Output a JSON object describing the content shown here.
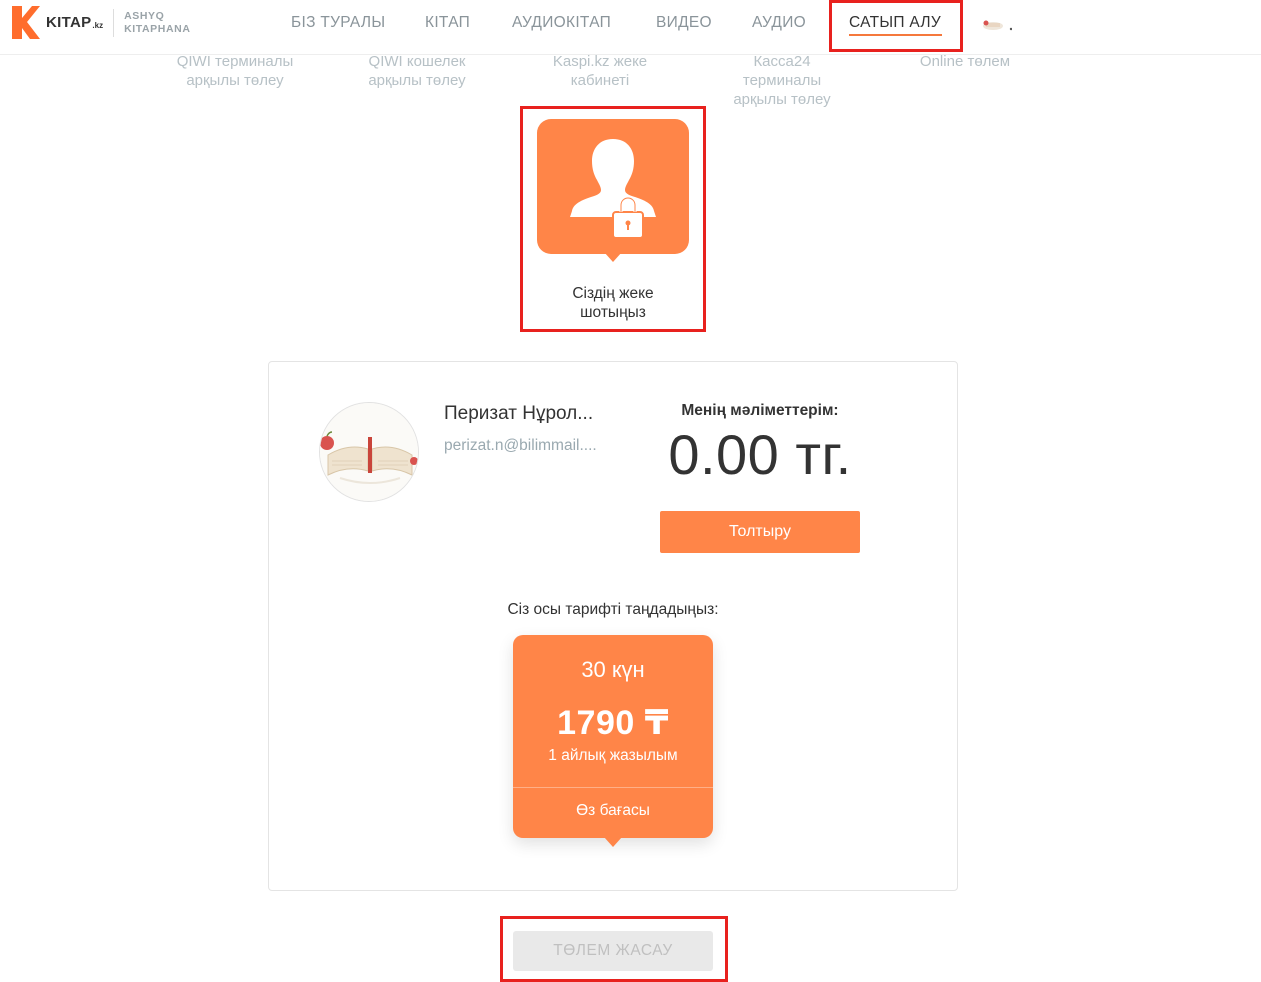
{
  "header": {
    "logo_text": "KITAP",
    "logo_kz": ".kz",
    "logo_sub_line1": "ASHYQ",
    "logo_sub_line2": "KITAPHANA",
    "nav": [
      {
        "label": "БІЗ ТУРАЛЫ"
      },
      {
        "label": "КІТАП"
      },
      {
        "label": "АУДИОКІТАП"
      },
      {
        "label": "ВИДЕО"
      },
      {
        "label": "АУДИО"
      },
      {
        "label": "САТЫП АЛУ",
        "active": true
      }
    ]
  },
  "payment_methods": [
    {
      "line1": "QIWI терминалы",
      "line2": "арқылы төлеу"
    },
    {
      "line1": "QIWI кошелек",
      "line2": "арқылы төлеу"
    },
    {
      "line1": "Kaspi.kz жеке",
      "line2": "кабинеті"
    },
    {
      "line1": "Касса24",
      "line2": "терминалы",
      "line3": "арқылы төлеу"
    },
    {
      "line1": "Online төлем"
    }
  ],
  "account": {
    "label_line1": "Сіздің жеке",
    "label_line2": "шотыңыз",
    "icon": "user-lock-icon"
  },
  "user": {
    "name": "Перизат Нұрол...",
    "email": "perizat.n@bilimmail...."
  },
  "wallet": {
    "my_data_label": "Менің мәліметтерім:",
    "balance": "0.00 тг.",
    "topup_label": "Толтыру"
  },
  "tariff": {
    "prompt": "Сіз осы тарифті таңдадыңыз:",
    "days": "30 күн",
    "price": "1790 ₸",
    "desc": "1 айлық жазылым",
    "own_price": "Өз бағасы"
  },
  "pay_button": "ТӨЛЕМ ЖАСАУ",
  "colors": {
    "accent": "#ff8548",
    "highlight": "#e8211e",
    "muted": "#b7c1c6"
  }
}
